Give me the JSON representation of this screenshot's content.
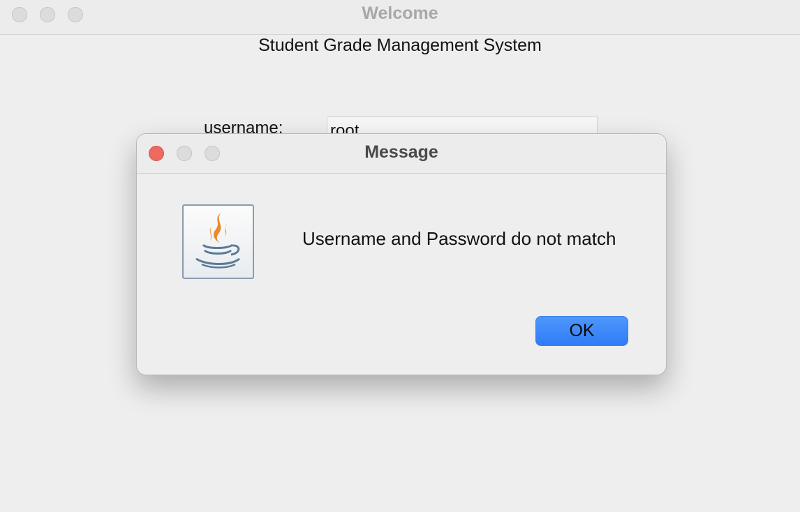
{
  "window": {
    "title": "Welcome",
    "heading": "Student Grade Management System"
  },
  "login": {
    "username_label": "username:",
    "username_value": "root"
  },
  "dialog": {
    "title": "Message",
    "icon": "java-coffee-cup-icon",
    "message": "Username and Password do not match",
    "ok_label": "OK"
  },
  "colors": {
    "close_red": "#ee6a5f",
    "accent_blue": "#3385f8",
    "window_bg": "#eeeeee"
  }
}
